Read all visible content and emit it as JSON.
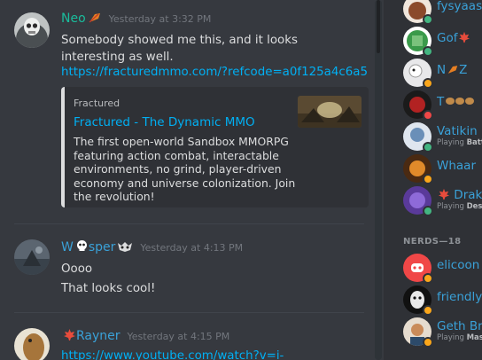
{
  "messages": [
    {
      "username": "Neo",
      "username_color": "#1abc9c",
      "timestamp": "Yesterday at 3:32 PM",
      "lines": [
        "Somebody showed me this, and it looks",
        "interesting as well."
      ],
      "link": "https://fracturedmmo.com/?refcode=a0f125a4c6a5",
      "embed": {
        "provider": "Fractured",
        "title": "Fractured - The Dynamic MMO",
        "description": [
          "The first open-world Sandbox MMORPG",
          "featuring action combat, interactable",
          "environments, no grind, player-driven",
          "economy and universe colonization. Join",
          "the revolution!"
        ]
      }
    },
    {
      "username_prefix": "W",
      "username_suffix": "sper",
      "username_color": "#3aa1d8",
      "timestamp": "Yesterday at 4:13 PM",
      "lines": [
        "Oooo",
        "That looks cool!"
      ]
    },
    {
      "username": "Rayner",
      "username_color": "#3aa1d8",
      "timestamp": "Yesterday at 4:15 PM",
      "link": "https://www.youtube.com/watch?v=i-"
    }
  ],
  "members": [
    {
      "name": "fysyaasfi",
      "status": "online",
      "status_color": "#43b581"
    },
    {
      "name": "Gof",
      "status": "online",
      "status_color": "#43b581"
    },
    {
      "name": "N",
      "name_suffix": "Z",
      "status": "idle",
      "status_color": "#faa61a"
    },
    {
      "name": "T",
      "status": "dnd",
      "status_color": "#f04747"
    },
    {
      "name": "Vatikin",
      "activity_prefix": "Playing",
      "activity": "Battl",
      "status": "online",
      "status_color": "#43b581"
    },
    {
      "name": "Whaar",
      "status": "idle",
      "status_color": "#faa61a"
    },
    {
      "name": "Drak",
      "activity_prefix": "Playing",
      "activity": "Dest",
      "status": "online",
      "status_color": "#43b581"
    }
  ],
  "group_header": "NERDS—18",
  "nerds": [
    {
      "name": "elicoon",
      "status": "idle",
      "status_color": "#faa61a"
    },
    {
      "name": "friendlyR",
      "status": "idle",
      "status_color": "#faa61a"
    },
    {
      "name": "Geth Bria",
      "activity_prefix": "Playing",
      "activity": "Mass",
      "status": "idle",
      "status_color": "#faa61a"
    }
  ]
}
